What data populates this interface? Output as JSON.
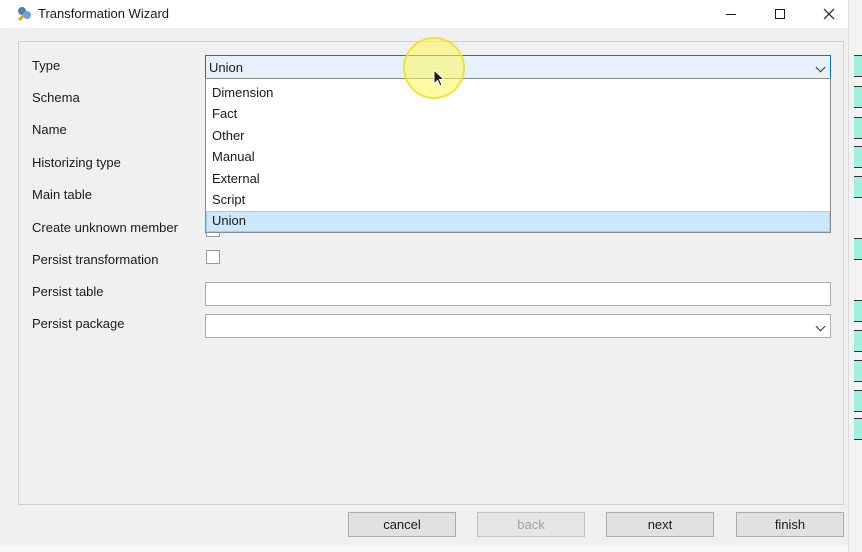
{
  "window": {
    "title": "Transformation Wizard",
    "controls": [
      "minimize",
      "maximize",
      "close"
    ]
  },
  "form": {
    "type_label": "Type",
    "type_value": "Union",
    "schema_label": "Schema",
    "name_label": "Name",
    "historizing_label": "Historizing type",
    "main_table_label": "Main table",
    "unknown_member_label": "Create unknown member",
    "persist_transformation_label": "Persist transformation",
    "persist_transformation_checked": false,
    "persist_table_label": "Persist table",
    "persist_table_value": "",
    "persist_package_label": "Persist package",
    "persist_package_value": ""
  },
  "type_dropdown": {
    "options": [
      "Dimension",
      "Fact",
      "Other",
      "Manual",
      "External",
      "Script",
      "Union"
    ],
    "selected": "Union"
  },
  "buttons": {
    "cancel": "cancel",
    "back": "back",
    "next": "next",
    "finish": "finish"
  },
  "colors": {
    "accent": "#0078d7",
    "selection": "#cce8ff",
    "cursor_highlight": "#fff85a"
  }
}
